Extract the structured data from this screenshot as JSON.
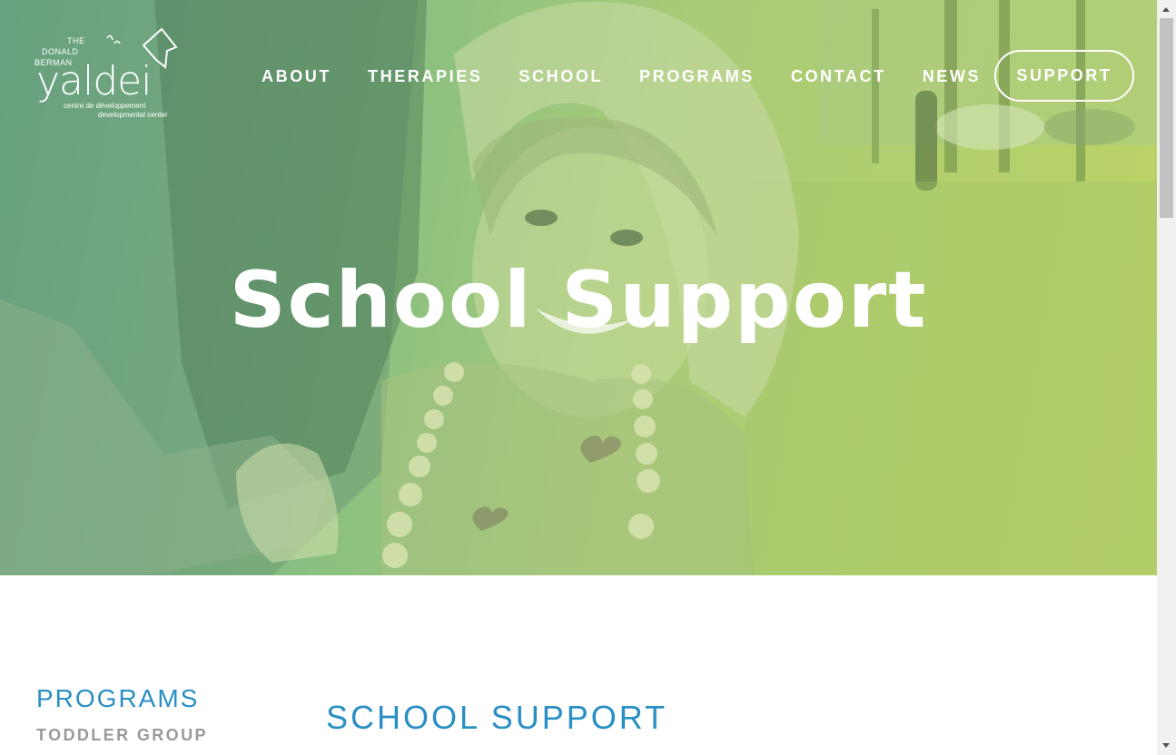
{
  "logo": {
    "the": "THE",
    "donald": "DONALD",
    "berman": "BERMAN",
    "brand": "yaldei",
    "tagline_fr": "centre de développement",
    "tagline_en": "developmental center"
  },
  "nav": {
    "items": [
      "ABOUT",
      "THERAPIES",
      "SCHOOL",
      "PROGRAMS",
      "CONTACT",
      "NEWS"
    ],
    "support": "SUPPORT"
  },
  "hero": {
    "title": "School Support"
  },
  "sidebar": {
    "heading": "PROGRAMS",
    "items": [
      "TODDLER GROUP"
    ]
  },
  "main": {
    "heading": "SCHOOL SUPPORT"
  },
  "colors": {
    "accent_blue": "#2a8fc4",
    "hero_gradient_start": "#5fa88c",
    "hero_gradient_end": "#bcd366",
    "sidebar_link_grey": "#9a9a9a"
  }
}
